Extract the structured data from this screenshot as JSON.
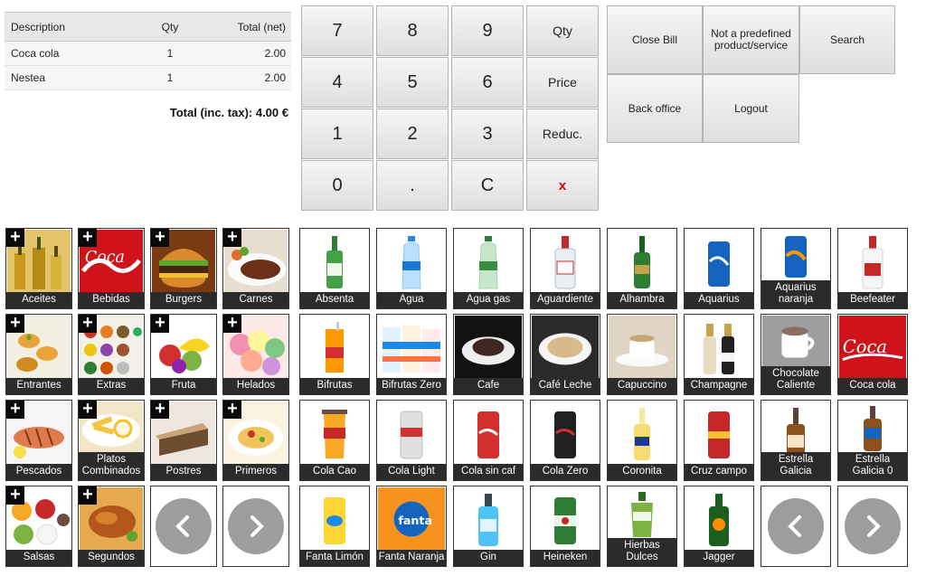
{
  "order": {
    "headers": {
      "description": "Description",
      "qty": "Qty",
      "total": "Total (net)"
    },
    "rows": [
      {
        "description": "Coca cola",
        "qty": "1",
        "total": "2.00"
      },
      {
        "description": "Nestea",
        "qty": "1",
        "total": "2.00"
      }
    ],
    "total_label": "Total (inc. tax): 4.00 €"
  },
  "keypad": {
    "k7": "7",
    "k8": "8",
    "k9": "9",
    "qty": "Qty",
    "k4": "4",
    "k5": "5",
    "k6": "6",
    "price": "Price",
    "k1": "1",
    "k2": "2",
    "k3": "3",
    "reduc": "Reduc.",
    "k0": "0",
    "dot": ".",
    "clear": "C",
    "delete": "x"
  },
  "actions": {
    "close_bill": "Close Bill",
    "not_predefined": "Not a predefined product/service",
    "search": "Search",
    "back_office": "Back office",
    "logout": "Logout"
  },
  "categories": [
    {
      "label": "Aceites",
      "icon": "olive-oil-bottles"
    },
    {
      "label": "Bebidas",
      "icon": "coca-cola-logo"
    },
    {
      "label": "Burgers",
      "icon": "hamburger"
    },
    {
      "label": "Carnes",
      "icon": "steak-plate"
    },
    {
      "label": "Entrantes",
      "icon": "appetizer-rolls"
    },
    {
      "label": "Extras",
      "icon": "spices-grid"
    },
    {
      "label": "Fruta",
      "icon": "fruit-basket"
    },
    {
      "label": "Helados",
      "icon": "ice-cream-scoops"
    },
    {
      "label": "Pescados",
      "icon": "grilled-fish"
    },
    {
      "label": "Platos Combinados",
      "icon": "combo-plate"
    },
    {
      "label": "Postres",
      "icon": "cake-slice"
    },
    {
      "label": "Primeros",
      "icon": "pasta-dish"
    },
    {
      "label": "Salsas",
      "icon": "sauce-bowls"
    },
    {
      "label": "Segundos",
      "icon": "roast-chicken"
    }
  ],
  "products": [
    {
      "label": "Absenta",
      "icon": "green-bottle"
    },
    {
      "label": "Agua",
      "icon": "water-bottle"
    },
    {
      "label": "Agua gas",
      "icon": "sparkling-water-bottle"
    },
    {
      "label": "Aguardiente",
      "icon": "liquor-bottle"
    },
    {
      "label": "Alhambra",
      "icon": "beer-bottle"
    },
    {
      "label": "Aquarius",
      "icon": "aquarius-can"
    },
    {
      "label": "Aquarius naranja",
      "icon": "aquarius-orange-can"
    },
    {
      "label": "Beefeater",
      "icon": "gin-bottle"
    },
    {
      "label": "Bifrutas",
      "icon": "juice-carton"
    },
    {
      "label": "Bifrutas Zero",
      "icon": "juice-cartons"
    },
    {
      "label": "Cafe",
      "icon": "coffee-cup"
    },
    {
      "label": "Café Leche",
      "icon": "latte-cup"
    },
    {
      "label": "Capuccino",
      "icon": "cappuccino-cup"
    },
    {
      "label": "Champagne",
      "icon": "champagne-bottle"
    },
    {
      "label": "Chocolate Caliente",
      "icon": "hot-chocolate-cup"
    },
    {
      "label": "Coca cola",
      "icon": "coca-cola-logo"
    },
    {
      "label": "Cola Cao",
      "icon": "cola-cao-cup"
    },
    {
      "label": "Cola Light",
      "icon": "cola-light-can"
    },
    {
      "label": "Cola sin caf",
      "icon": "cola-can"
    },
    {
      "label": "Cola Zero",
      "icon": "cola-zero-can"
    },
    {
      "label": "Coronita",
      "icon": "corona-bottle"
    },
    {
      "label": "Cruz campo",
      "icon": "cruzcampo-can"
    },
    {
      "label": "Estrella Galicia",
      "icon": "amber-beer-bottle"
    },
    {
      "label": "Estrella Galicia 0",
      "icon": "amber-beer-bottle-zero"
    },
    {
      "label": "Fanta Limón",
      "icon": "fanta-lemon-can"
    },
    {
      "label": "Fanta Naranja",
      "icon": "fanta-orange-logo"
    },
    {
      "label": "Gin",
      "icon": "blue-gin-bottle"
    },
    {
      "label": "Heineken",
      "icon": "heineken-can"
    },
    {
      "label": "Hierbas Dulces",
      "icon": "herbal-liqueur-bottle"
    },
    {
      "label": "Jagger",
      "icon": "jagermeister-bottle"
    }
  ],
  "colors": {
    "tile_label_bg": "#2b2b2b",
    "nav_circle": "#9d9d9d",
    "delete_red": "#dd0000"
  }
}
